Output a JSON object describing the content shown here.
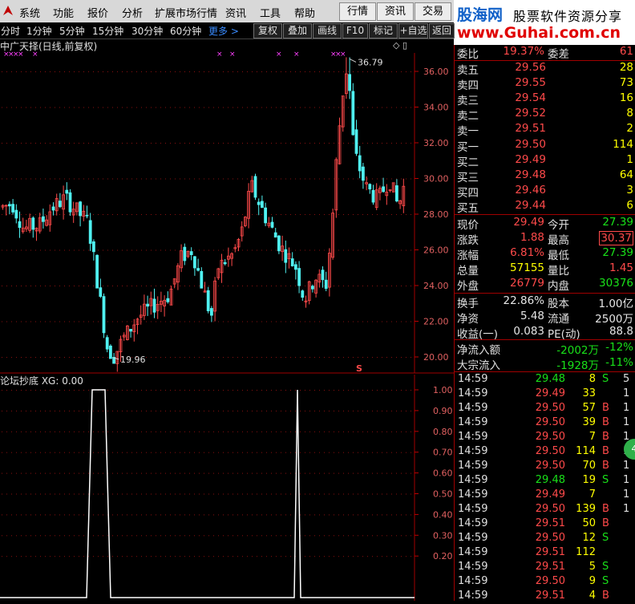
{
  "menu": {
    "items": [
      "系统",
      "功能",
      "报价",
      "分析",
      "扩展市场行情",
      "资讯",
      "工具",
      "帮助"
    ],
    "right_tabs": [
      "行情",
      "资讯",
      "交易"
    ]
  },
  "brand": {
    "cn": "股海网",
    "slogan": "股票软件资源分享",
    "url": "www.Guhai.com.cn"
  },
  "toolbar": {
    "periods": [
      "分时",
      "1分钟",
      "5分钟",
      "15分钟",
      "30分钟",
      "60分钟"
    ],
    "more": "更多 >",
    "buttons": [
      "复权",
      "叠加",
      "画线",
      "F10",
      "标记",
      "+自选",
      "返回"
    ]
  },
  "chart": {
    "title": "中广天择(日线,前复权)",
    "high_label": "36.79",
    "low_label": "19.96",
    "y_ticks": [
      "36.00",
      "34.00",
      "32.00",
      "30.00",
      "28.00",
      "26.00",
      "24.00",
      "22.00",
      "20.00"
    ],
    "s_marker": "S"
  },
  "indicator": {
    "title": "论坛抄底 XG: 0.00",
    "y_ticks": [
      "1.00",
      "0.90",
      "0.80",
      "0.70",
      "0.60",
      "0.50",
      "0.40",
      "0.30",
      "0.20"
    ]
  },
  "panel": {
    "committee": {
      "label1": "委比",
      "value1": "19.37%",
      "label2": "委差",
      "value2": "61"
    },
    "sells": [
      {
        "label": "卖五",
        "price": "29.56",
        "vol": "28"
      },
      {
        "label": "卖四",
        "price": "29.55",
        "vol": "73"
      },
      {
        "label": "卖三",
        "price": "29.54",
        "vol": "16"
      },
      {
        "label": "卖二",
        "price": "29.52",
        "vol": "8"
      },
      {
        "label": "卖一",
        "price": "29.51",
        "vol": "2"
      }
    ],
    "buys": [
      {
        "label": "买一",
        "price": "29.50",
        "vol": "114"
      },
      {
        "label": "买二",
        "price": "29.49",
        "vol": "1"
      },
      {
        "label": "买三",
        "price": "29.48",
        "vol": "64"
      },
      {
        "label": "买四",
        "price": "29.46",
        "vol": "3"
      },
      {
        "label": "买五",
        "price": "29.44",
        "vol": "6"
      }
    ],
    "quote": [
      {
        "l1": "现价",
        "v1": "29.49",
        "c1": "red",
        "l2": "今开",
        "v2": "27.39",
        "c2": "green"
      },
      {
        "l1": "涨跌",
        "v1": "1.88",
        "c1": "red",
        "l2": "最高",
        "v2": "30.37",
        "c2": "red",
        "boxed": true
      },
      {
        "l1": "涨幅",
        "v1": "6.81%",
        "c1": "red",
        "l2": "最低",
        "v2": "27.39",
        "c2": "green"
      },
      {
        "l1": "总量",
        "v1": "57155",
        "c1": "yellow",
        "l2": "量比",
        "v2": "1.45",
        "c2": "red"
      },
      {
        "l1": "外盘",
        "v1": "26779",
        "c1": "red",
        "l2": "内盘",
        "v2": "30376",
        "c2": "green"
      }
    ],
    "stats": [
      {
        "l1": "换手",
        "v1": "22.86%",
        "l2": "股本",
        "v2": "1.00亿"
      },
      {
        "l1": "净资",
        "v1": "5.48",
        "l2": "流通",
        "v2": "2500万"
      },
      {
        "l1": "收益(一)",
        "v1": "0.083",
        "l2": "PE(动)",
        "v2": "88.8"
      }
    ],
    "flows": [
      {
        "label": "净流入额",
        "value": "-2002万",
        "pct": "-12%"
      },
      {
        "label": "大宗流入",
        "value": "-1928万",
        "pct": "-11%"
      }
    ],
    "ticks": [
      {
        "time": "14:59",
        "price": "29.48",
        "vol": "8",
        "dir": "S",
        "n": "5"
      },
      {
        "time": "14:59",
        "price": "29.49",
        "vol": "33",
        "dir": "",
        "n": "1"
      },
      {
        "time": "14:59",
        "price": "29.50",
        "vol": "57",
        "dir": "B",
        "n": "1"
      },
      {
        "time": "14:59",
        "price": "29.50",
        "vol": "39",
        "dir": "B",
        "n": "1"
      },
      {
        "time": "14:59",
        "price": "29.50",
        "vol": "7",
        "dir": "B",
        "n": "1"
      },
      {
        "time": "14:59",
        "price": "29.50",
        "vol": "114",
        "dir": "B",
        "n": "1"
      },
      {
        "time": "14:59",
        "price": "29.50",
        "vol": "70",
        "dir": "B",
        "n": "1"
      },
      {
        "time": "14:59",
        "price": "29.48",
        "vol": "19",
        "dir": "S",
        "n": "1"
      },
      {
        "time": "14:59",
        "price": "29.49",
        "vol": "7",
        "dir": "",
        "n": "1"
      },
      {
        "time": "14:59",
        "price": "29.50",
        "vol": "139",
        "dir": "B",
        "n": "1"
      },
      {
        "time": "14:59",
        "price": "29.51",
        "vol": "50",
        "dir": "B",
        "n": ""
      },
      {
        "time": "14:59",
        "price": "29.50",
        "vol": "12",
        "dir": "S",
        "n": ""
      },
      {
        "time": "14:59",
        "price": "29.51",
        "vol": "112",
        "dir": "",
        "n": ""
      },
      {
        "time": "14:59",
        "price": "29.51",
        "vol": "5",
        "dir": "S",
        "n": ""
      },
      {
        "time": "14:59",
        "price": "29.50",
        "vol": "9",
        "dir": "S",
        "n": ""
      },
      {
        "time": "14:59",
        "price": "29.51",
        "vol": "4",
        "dir": "B",
        "n": ""
      }
    ],
    "circle_badge": "4"
  },
  "colors": {
    "up": "#ff4a4a",
    "down": "#4ff0f0",
    "panel_border": "#a00000",
    "signal": "#ffffff"
  }
}
